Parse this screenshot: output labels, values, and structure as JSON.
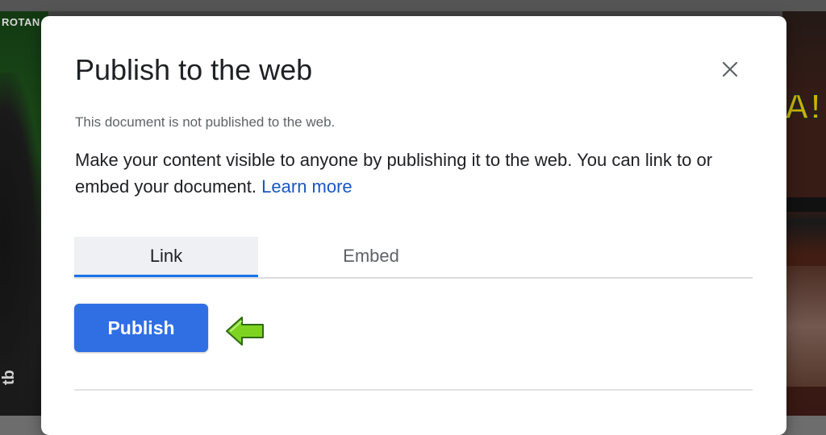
{
  "background": {
    "corner_text": "ROTAN",
    "banner_text": "A!",
    "side_text": "tb"
  },
  "dialog": {
    "title": "Publish to the web",
    "close_icon": "close-icon",
    "status": "This document is not published to the web.",
    "description": "Make your content visible to anyone by publishing it to the web. You can link to or embed your document.",
    "learn_more": "Learn more"
  },
  "tabs": [
    {
      "label": "Link",
      "active": true
    },
    {
      "label": "Embed",
      "active": false
    }
  ],
  "actions": {
    "publish_label": "Publish"
  },
  "annotation": {
    "icon": "green-arrow-icon"
  },
  "colors": {
    "accent": "#1a73e8",
    "button": "#2f6fe3",
    "link": "#1a56c4",
    "arrow": "#7ed321"
  }
}
